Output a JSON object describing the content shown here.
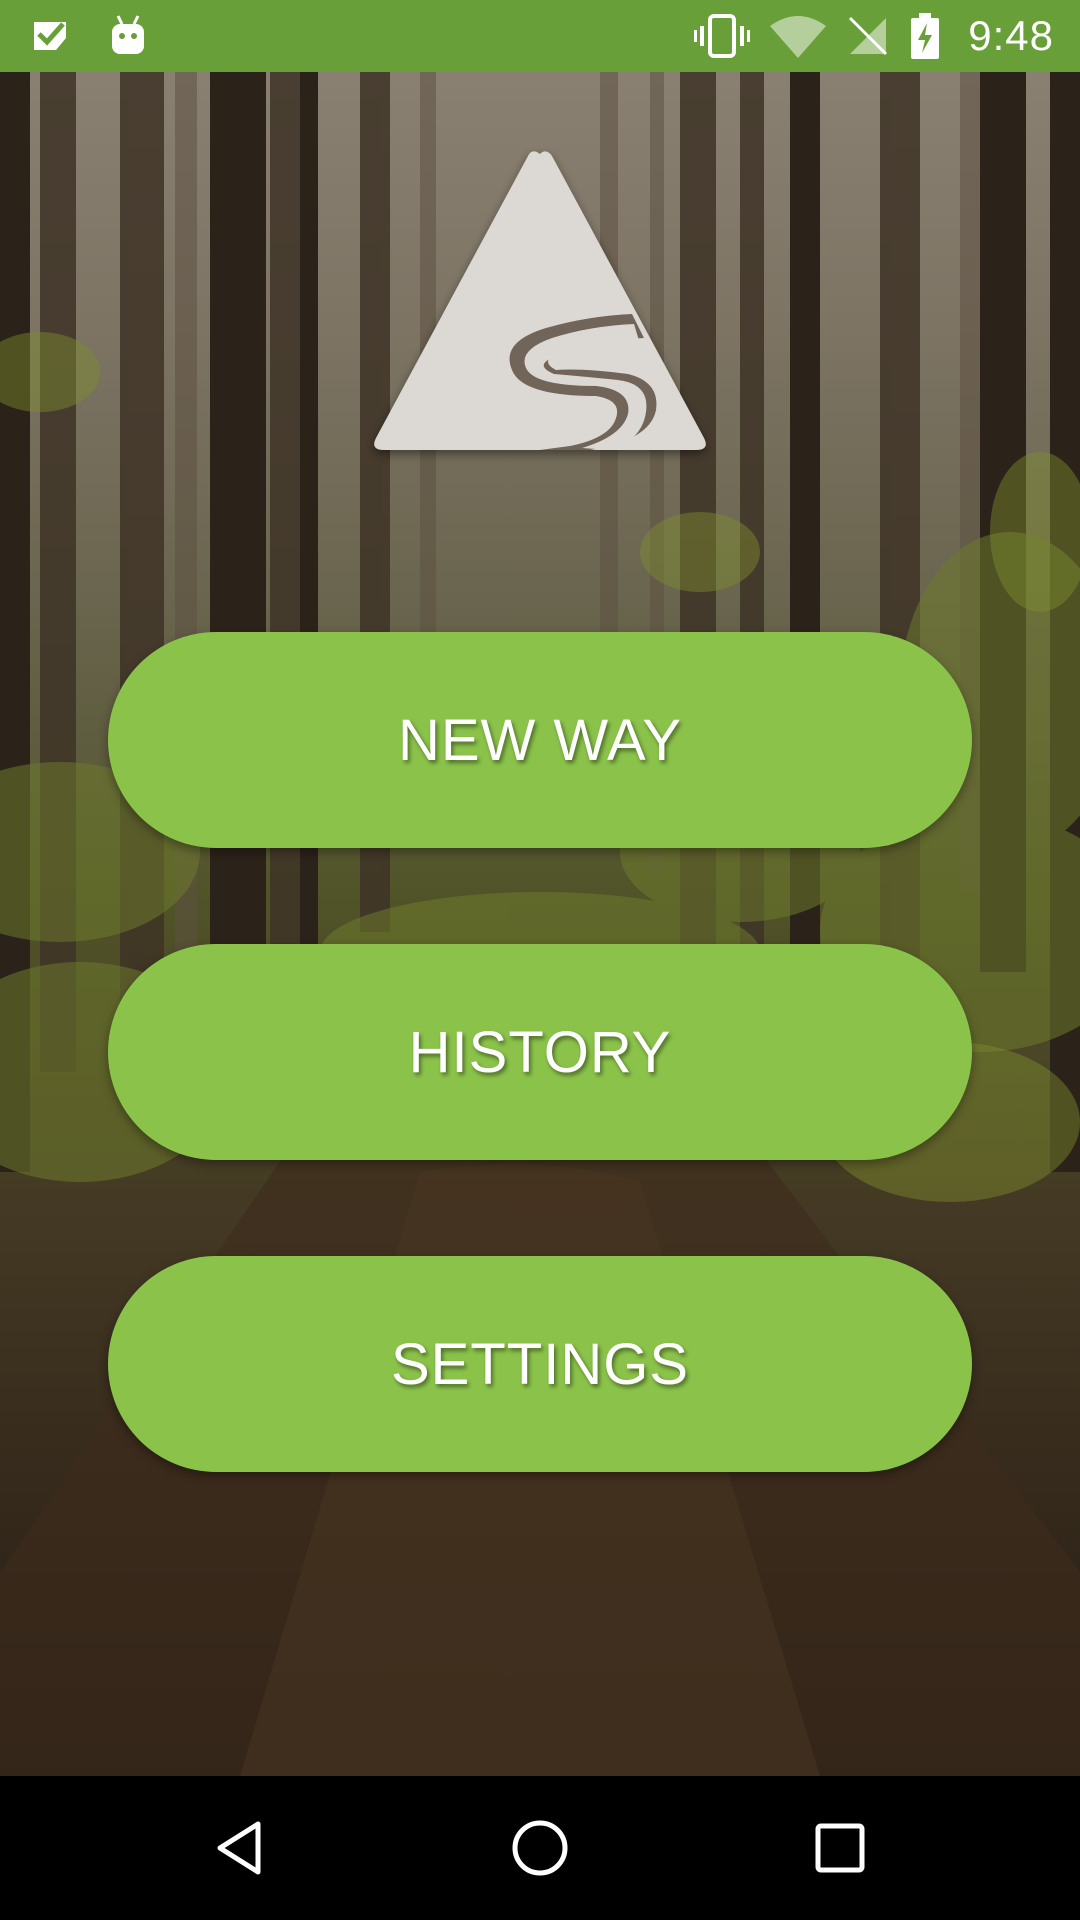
{
  "status_bar": {
    "time": "9:48",
    "left_icons": [
      "tasks-check-icon",
      "android-robot-icon"
    ],
    "right_icons": [
      "vibrate-icon",
      "wifi-icon",
      "no-signal-icon",
      "battery-charging-icon"
    ],
    "background_color": "#689f38"
  },
  "logo": {
    "icon": "mountain-trail-logo-icon"
  },
  "menu": {
    "new_way_label": "NEW WAY",
    "history_label": "HISTORY",
    "settings_label": "SETTINGS",
    "button_color": "#8bc34a"
  },
  "nav_bar": {
    "icons": [
      "back-icon",
      "home-icon",
      "recents-icon"
    ]
  }
}
